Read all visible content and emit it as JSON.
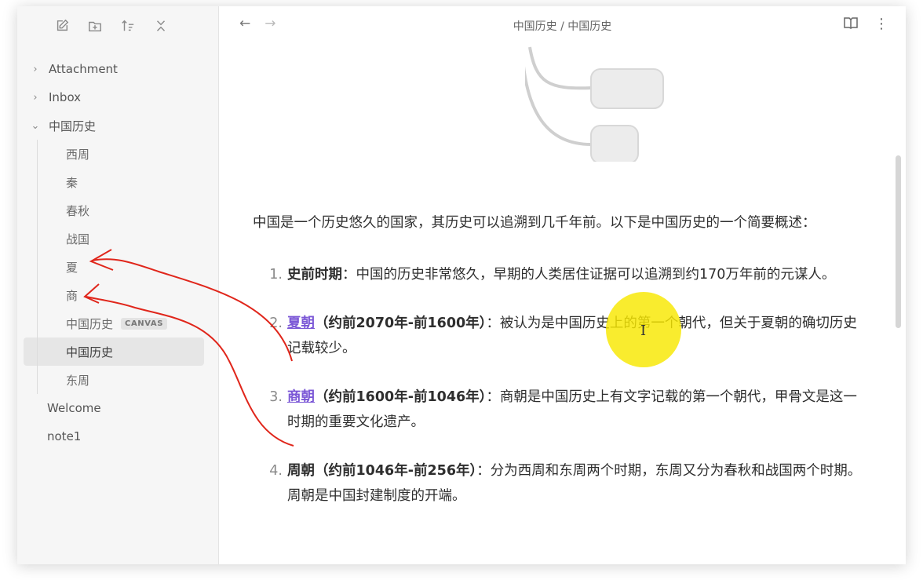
{
  "sidebar": {
    "toolbar": [
      {
        "icon": "new-note-icon"
      },
      {
        "icon": "new-folder-icon"
      },
      {
        "icon": "sort-icon"
      },
      {
        "icon": "collapse-all-icon"
      }
    ],
    "folders": {
      "attachment": "Attachment",
      "inbox": "Inbox",
      "history": "中国历史"
    },
    "children": [
      "西周",
      "秦",
      "春秋",
      "战国",
      "夏",
      "商"
    ],
    "canvas_file": "中国历史",
    "canvas_badge": "CANVAS",
    "active_file": "中国历史",
    "last_child": "东周",
    "root_files": [
      "Welcome",
      "note1"
    ],
    "chevrons": {
      "collapsed": "›",
      "expanded": "⌄"
    }
  },
  "topbar": {
    "back": "←",
    "forward": "→",
    "breadcrumb": "中国历史 / 中国历史",
    "reading_icon": "book-icon",
    "more": "⋮"
  },
  "content": {
    "intro": "中国是一个历史悠久的国家，其历史可以追溯到几千年前。以下是中国历史的一个简要概述：",
    "items": [
      {
        "num": "1.",
        "title": "史前时期",
        "period": "",
        "text": "：中国的历史非常悠久，早期的人类居住证据可以追溯到约170万年前的元谋人。"
      },
      {
        "num": "2.",
        "title": "夏朝",
        "period": "（约前2070年-前1600年）",
        "text": "：被认为是中国历史上的第一个朝代，但关于夏朝的确切历史记载较少。"
      },
      {
        "num": "3.",
        "title": "商朝",
        "period": "（约前1600年-前1046年）",
        "text": "：商朝是中国历史上有文字记载的第一个朝代，甲骨文是这一时期的重要文化遗产。"
      },
      {
        "num": "4.",
        "title": "周朝",
        "period": "（约前1046年-前256年）",
        "text": "：分为西周和东周两个时期，东周又分为春秋和战国两个时期。周朝是中国封建制度的开端。"
      }
    ],
    "cursor": "I"
  },
  "colors": {
    "link": "#7b57d6",
    "highlight": "#f8e800",
    "annotation": "#e0261b"
  }
}
